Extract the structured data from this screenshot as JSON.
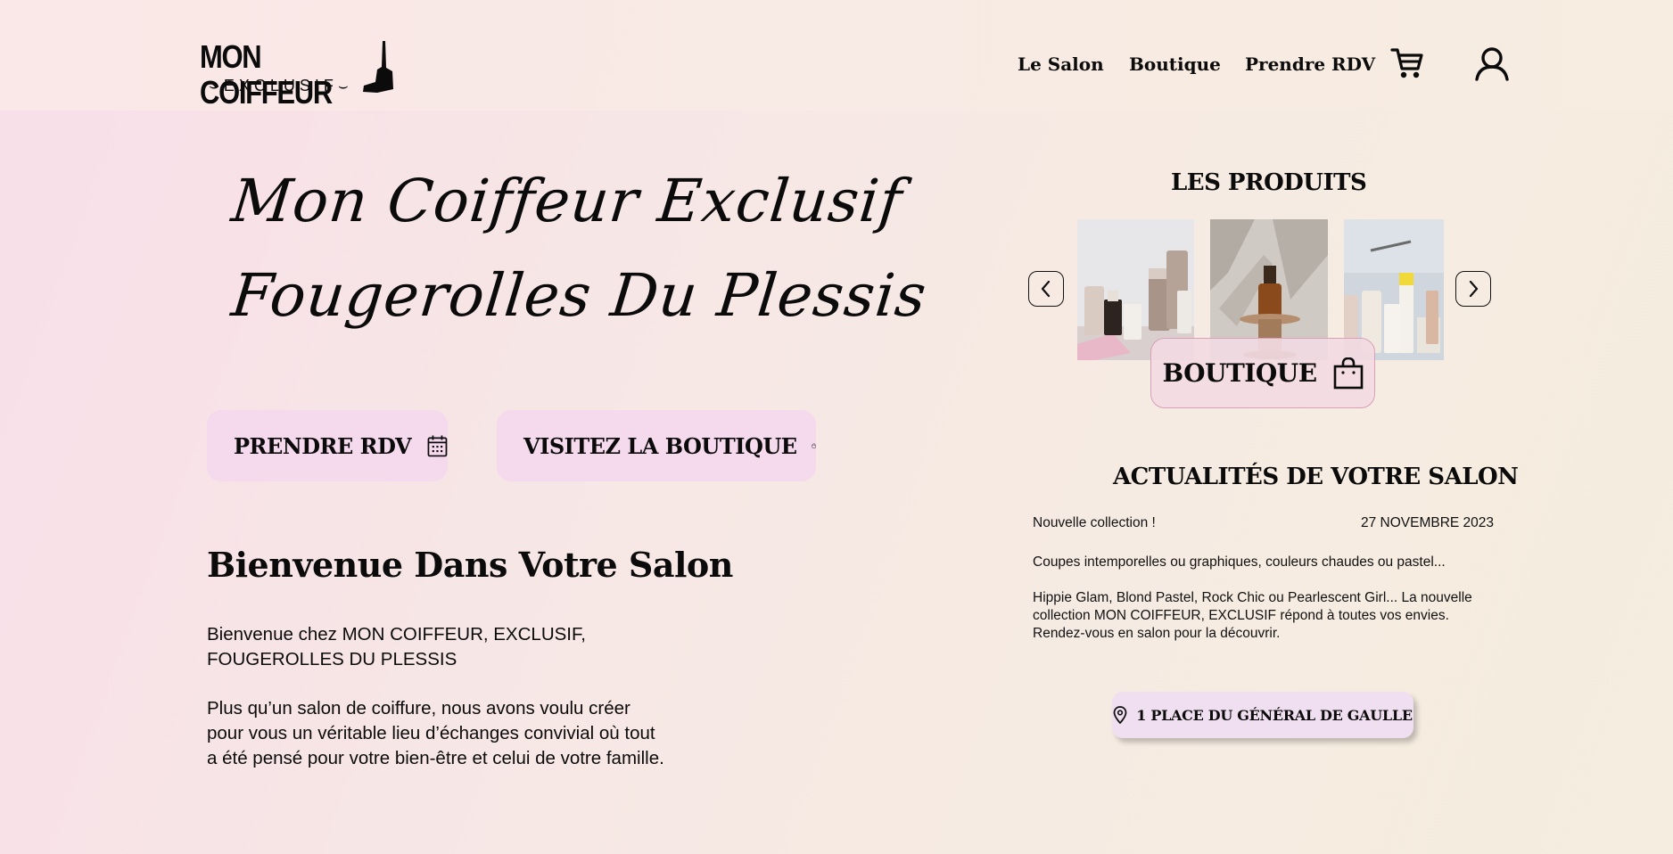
{
  "header": {
    "logo_title": "MON COIFFEUR",
    "logo_subtitle": "⌣EXCLUSIF⌣",
    "nav": [
      "Le Salon",
      "Boutique",
      "Prendre RDV"
    ],
    "cart_icon": "cart-icon",
    "account_icon": "user-icon"
  },
  "hero": {
    "title_line1": "Mon Coiffeur Exclusif",
    "title_line2": "Fougerolles Du Plessis"
  },
  "buttons": {
    "rdv_label": "PRENDRE RDV",
    "rdv_icon": "calendar-icon",
    "shop_label": "VISITEZ LA BOUTIQUE",
    "shop_icon": "shopping-bag-icon"
  },
  "welcome": {
    "heading": "Bienvenue Dans Votre Salon",
    "para1_line1": "Bienvenue chez MON COIFFEUR, EXCLUSIF,",
    "para1_line2": "FOUGEROLLES DU PLESSIS",
    "para2_line1": "Plus qu’un salon de coiffure, nous avons voulu créer",
    "para2_line2": "pour vous un véritable lieu d’échanges convivial où tout",
    "para2_line3": "a été pensé pour votre bien-être et celui de votre famille."
  },
  "products": {
    "title": "LES PRODUITS",
    "overlay_label": "BOUTIQUE",
    "overlay_icon": "shopping-bag-icon",
    "prev_icon": "chevron-left-icon",
    "next_icon": "chevron-right-icon"
  },
  "news": {
    "title": "ACTUALITÉS DE VOTRE SALON",
    "item_title": "Nouvelle collection !",
    "item_date": "27 NOVEMBRE 2023",
    "item_intro": "Coupes intemporelles ou graphiques, couleurs chaudes ou pastel...",
    "item_body_line1": "Hippie Glam, Blond Pastel, Rock Chic ou Pearlescent Girl... La nouvelle",
    "item_body_line2": "collection MON COIFFEUR, EXCLUSIF répond à toutes vos envies.",
    "item_body_line3": "Rendez-vous en salon pour la découvrir."
  },
  "address": {
    "label": "1 PLACE DU GÉNÉRAL DE GAULLE",
    "icon": "map-pin-icon"
  },
  "colors": {
    "button_bg": "#f5d9ec",
    "address_bg": "#f0dff0",
    "overlay_border": "#d9a0b8"
  }
}
